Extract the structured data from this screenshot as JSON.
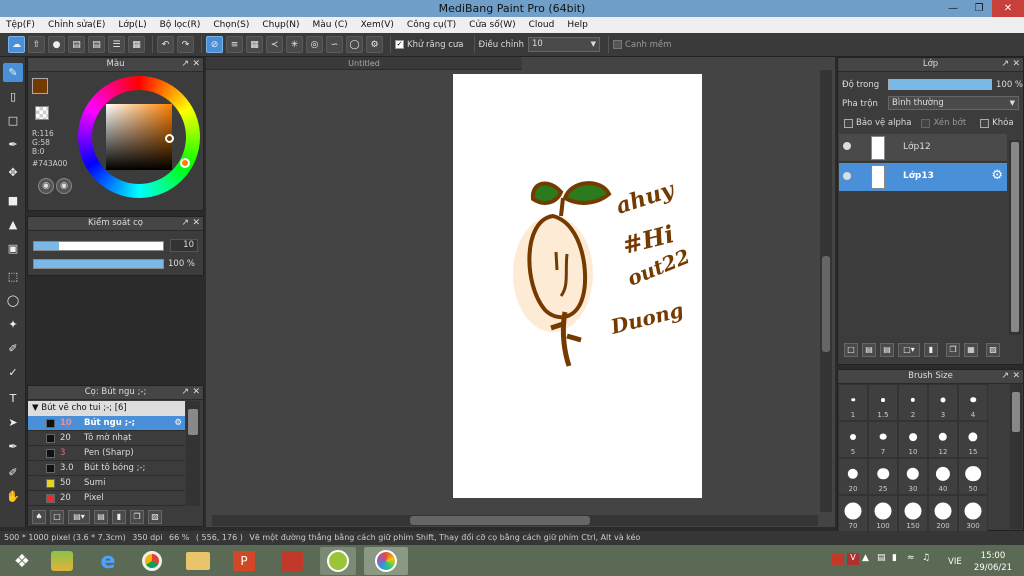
{
  "window": {
    "title": "MediBang Paint Pro (64bit)"
  },
  "menu": [
    "Tệp(F)",
    "Chỉnh sửa(E)",
    "Lớp(L)",
    "Bộ lọc(R)",
    "Chọn(S)",
    "Chụp(N)",
    "Màu (C)",
    "Xem(V)",
    "Công cụ(T)",
    "Cửa số(W)",
    "Cloud",
    "Help"
  ],
  "toolbar": {
    "antialias_label": "Khử răng cưa",
    "adjust_label": "Điều chỉnh",
    "adjust_value": "10",
    "edge_label": "Canh mềm"
  },
  "color_panel": {
    "title": "Màu",
    "r": "R:116",
    "g": "G:58",
    "b": "B:0",
    "hex": "#743A00",
    "current_color": "#743A00"
  },
  "brush_control": {
    "title": "Kiểm soát cọ",
    "size": "10",
    "opacity": "100 %"
  },
  "canvas": {
    "tab": "Untitled",
    "paper_color": "#FFFFFF",
    "drawing_text": [
      "ahuy",
      "#Hi",
      "out22",
      "Duong"
    ]
  },
  "brush_panel": {
    "title": "Cọ: Bút ngu ;-;",
    "group": "Bút vẽ cho tui ;-; [6]",
    "items": [
      {
        "size": "10",
        "name": "Bút ngu ;-;",
        "selected": true,
        "color": "#111111"
      },
      {
        "size": "20",
        "name": "Tô mờ nhạt",
        "selected": false,
        "color": "#111111"
      },
      {
        "size": "3",
        "name": "Pen (Sharp)",
        "selected": false,
        "color": "#111111"
      },
      {
        "size": "3.0",
        "name": "Bút tô bóng ;-;",
        "selected": false,
        "color": "#111111"
      },
      {
        "size": "50",
        "name": "Sumi",
        "selected": false,
        "color": "#e8d41a"
      },
      {
        "size": "20",
        "name": "Pixel",
        "selected": false,
        "color": "#e03030"
      }
    ]
  },
  "layer_panel": {
    "title": "Lớp",
    "opacity_label": "Độ trong",
    "opacity_value": "100 %",
    "blend_label": "Pha trộn",
    "blend_value": "Bình thường",
    "protect_alpha": "Bảo vệ alpha",
    "clipping": "Xén bớt",
    "lock": "Khóa",
    "layers": [
      {
        "name": "Lớp12",
        "selected": false
      },
      {
        "name": "Lớp13",
        "selected": true
      }
    ]
  },
  "brush_size_panel": {
    "title": "Brush Size",
    "sizes": [
      "1",
      "1.5",
      "2",
      "3",
      "4",
      "5",
      "7",
      "10",
      "12",
      "15",
      "20",
      "25",
      "30",
      "40",
      "50",
      "70",
      "100",
      "150",
      "200",
      "300"
    ]
  },
  "statusbar": {
    "size": "500 * 1000 pixel",
    "cm": "(3.6 * 7.3cm)",
    "dpi": "350 dpi",
    "zoom": "66 %",
    "coords": "( 556, 176 )",
    "hint": "Vẽ một đường thẳng bằng cách giữ phím Shift, Thay đổi cỡ cọ bằng cách giữ phím Ctrl, Alt và kéo"
  },
  "taskbar": {
    "lang": "VIE",
    "time": "15:00",
    "date": "29/06/21"
  }
}
